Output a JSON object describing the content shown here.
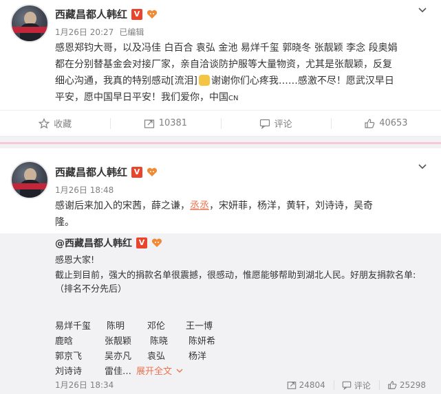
{
  "colors": {
    "accent": "#eb7350",
    "meta_gray": "#808080",
    "vip_badge": "#e8452c",
    "divider_pink": "#f6c9d4"
  },
  "post1": {
    "author": "西藏昌都人韩红",
    "verified_badge": "V",
    "time": "1月26日 20:27",
    "edited": "已编辑",
    "content": {
      "line1": "感恩郑钧大哥，以及冯佳 白百合 袁弘 金池 易烊千玺 郭晓冬 张靓颖 李念 段奥娟",
      "line2": "都在分别替基金会对接厂家，亲自洽谈防护服等大量物资，尤其是张靓颖，反复",
      "line3_a": "细心沟通，我真的特别感动[流泪]",
      "line3_b": "谢谢你们心疼我……感激不尽！愿武汉早日",
      "line4": "平安，愿中国早日平安！我们爱你，中国",
      "line4_flag": "CN"
    },
    "actions": {
      "favorite": "收藏",
      "repost_count": "10381",
      "comment": "评论",
      "like_count": "40653"
    }
  },
  "post2": {
    "author": "西藏昌都人韩红",
    "verified_badge": "V",
    "time": "1月26日 18:48",
    "content": {
      "line1_a": "感谢后来加入的宋茜，薛之谦，",
      "line1_link": "丞丞",
      "line1_b": "，宋妍菲，杨洋，黄轩，刘诗诗，吴奇",
      "line2": "隆。"
    },
    "repost": {
      "author": "@西藏昌都人韩红",
      "verified_badge": "V",
      "line1": "感恩大家!",
      "line2": "截止到目前，强大的捐款名单很震撼，很感动，惟愿能够帮助到湖北人民。好朋友捐款名单:",
      "line3": "（排名不分先后）",
      "donors": [
        [
          "易烊千玺",
          "陈明",
          "邓伦",
          "王一博"
        ],
        [
          "鹿晗",
          "张靓颖",
          "陈晓",
          "陈妍希"
        ],
        [
          "郭京飞",
          "吴亦凡",
          "袁弘",
          "杨洋"
        ],
        [
          "刘诗诗",
          "雷佳…"
        ]
      ],
      "expand": "展开全文",
      "time": "1月26日 18:34",
      "repost_count": "24804",
      "comment": "评论",
      "like_count": "25298"
    }
  }
}
